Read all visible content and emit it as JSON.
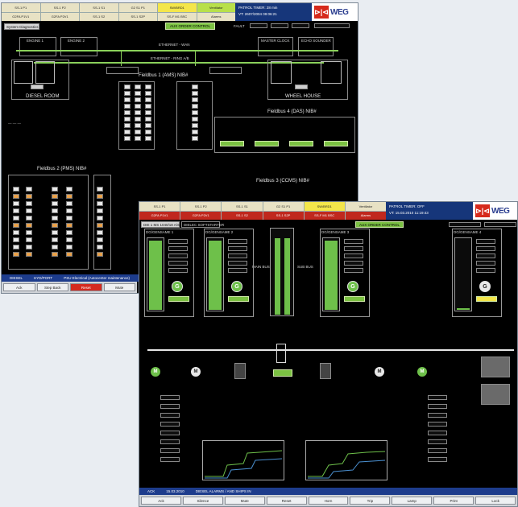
{
  "window1": {
    "tabs": [
      "SS-1 P1",
      "SS-1 P2",
      "SS-1 S1",
      "G2 S1 P1",
      "SW/BRD1",
      "Ventilator",
      "G2FA P1V1",
      "G2FA P2V1",
      "SS-1 S2",
      "SS-1 S2P",
      "SS-F M1 BSC",
      "Alarms"
    ],
    "patrol": {
      "line1": "PATROL TIMER: 28 min",
      "line2": "VT: 2607/2004  09:06:21"
    },
    "logo": {
      "mark": "⊳|⊲",
      "word": "WEG"
    },
    "diag_label": "System Diagnostics",
    "control_btn": "AUX ORDER CONTROL",
    "fields": {
      "label1": "FAULT"
    },
    "rooms": [
      "DIESEL ROOM",
      "WHEEL HOUSE"
    ],
    "panels": [
      "ENGINE 1",
      "ENGINE 2",
      "MASTER CLOCK",
      "ECHO SOUNDER"
    ],
    "network_top": "ETHERNET - WAN",
    "network_mid": "ETHERNET - RING A/B",
    "fieldbus": [
      "Fieldbus 1 (AMS) NIB#",
      "Fieldbus 2 (PMS) NIB#",
      "Fieldbus 3 (CCMS) NIB#",
      "Fieldbus 4 (DAS) NIB#"
    ],
    "status": [
      "DIESEL",
      "HYD/PORT",
      "PSU Electrical (Autocenter maintenance)"
    ],
    "buttons": [
      "Ack",
      "Step Back",
      "Reset",
      "Mute"
    ]
  },
  "window2": {
    "tabs": [
      "SS-1 P1",
      "SS-1 P2",
      "SS-1 S1",
      "G2 S1 P1",
      "SW/BRD1",
      "Ventilator",
      "G2FA P1V1",
      "G2FA P2V1",
      "SS-1 S2",
      "SS-1 S2P",
      "SS-F M1 BSC",
      "Alarms"
    ],
    "patrol": {
      "line1": "PATROL TIMER: OFF",
      "line2": "VT: 15.03.2010  11:19:43"
    },
    "logo": {
      "mark": "⊳|⊲",
      "word": "WEG"
    },
    "left_tabs": [
      "DIE 1 MS 1040/18 A/S",
      "DIELEC SOFTSTARTER"
    ],
    "control_btn": "AUX ORDER CONTROL",
    "generators": [
      "G",
      "G",
      "G",
      "G"
    ],
    "gen_labels": [
      "DG/GENSAME 1",
      "DG/GENSAME 2",
      "DG/GENSAME 3",
      "DG/GENSAME 4"
    ],
    "motors": [
      "M",
      "M",
      "M",
      "M"
    ],
    "readout_labels": [
      "MAIN BUS",
      "SUB BUS",
      "FEED 1",
      "FEED 2"
    ],
    "status": [
      "ACK",
      "15.03.2010",
      "DIESEL ALARMS / AND SHIPS IN"
    ],
    "buttons": [
      "Ack",
      "Silence",
      "Mute",
      "Reset",
      "Horn",
      "Trip",
      "Lamp",
      "Print",
      "Lock"
    ]
  },
  "colors": {
    "green": "#6ec04a",
    "blue": "#16367a",
    "red": "#d62a1c",
    "yellow": "#f4e64a"
  }
}
